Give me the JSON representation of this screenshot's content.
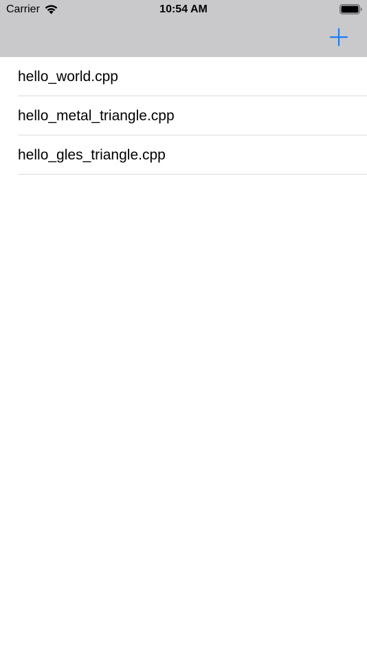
{
  "status_bar": {
    "carrier": "Carrier",
    "time": "10:54 AM",
    "wifi_icon": "wifi-icon",
    "battery_icon": "battery-full-icon"
  },
  "nav_bar": {
    "add_icon": "plus-icon",
    "accent_color": "#1a7cf5",
    "background_color": "#c9c9cb"
  },
  "files": {
    "items": [
      {
        "label": "hello_world.cpp"
      },
      {
        "label": "hello_metal_triangle.cpp"
      },
      {
        "label": "hello_gles_triangle.cpp"
      }
    ]
  }
}
